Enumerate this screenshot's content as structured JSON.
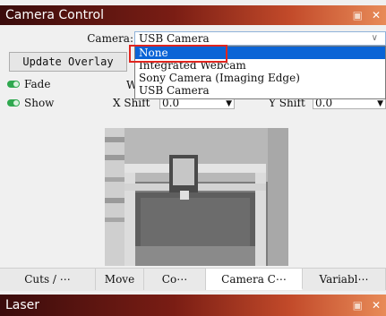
{
  "windows": {
    "camera_control": {
      "title": "Camera Control",
      "pin_icon": "pin-icon",
      "close_icon": "close-icon"
    },
    "laser": {
      "title": "Laser",
      "pin_icon": "pin-icon",
      "close_icon": "close-icon"
    }
  },
  "camera": {
    "label": "Camera:",
    "selected": "USB Camera",
    "options": [
      "None",
      "Integrated Webcam",
      "Sony Camera (Imaging Edge)",
      "USB Camera"
    ],
    "highlighted_option": "None"
  },
  "controls": {
    "update_overlay": "Update Overlay",
    "fade_label": "Fade",
    "show_label": "Show",
    "w_label": "W",
    "x_shift_label": "X Shift",
    "x_shift_value": "0.0",
    "y_shift_label": "Y Shift",
    "y_shift_value": "0.0",
    "toggle_color": "#2fa84f"
  },
  "tabs": [
    "Cuts / ⋯",
    "Move",
    "Co⋯",
    "Camera C⋯",
    "Variabl⋯"
  ],
  "active_tab": "Camera C⋯",
  "colors": {
    "titlebar_start": "#3a0c0c",
    "titlebar_end": "#e88b58",
    "selection": "#0a64d6",
    "highlight_box": "#e0251f"
  }
}
